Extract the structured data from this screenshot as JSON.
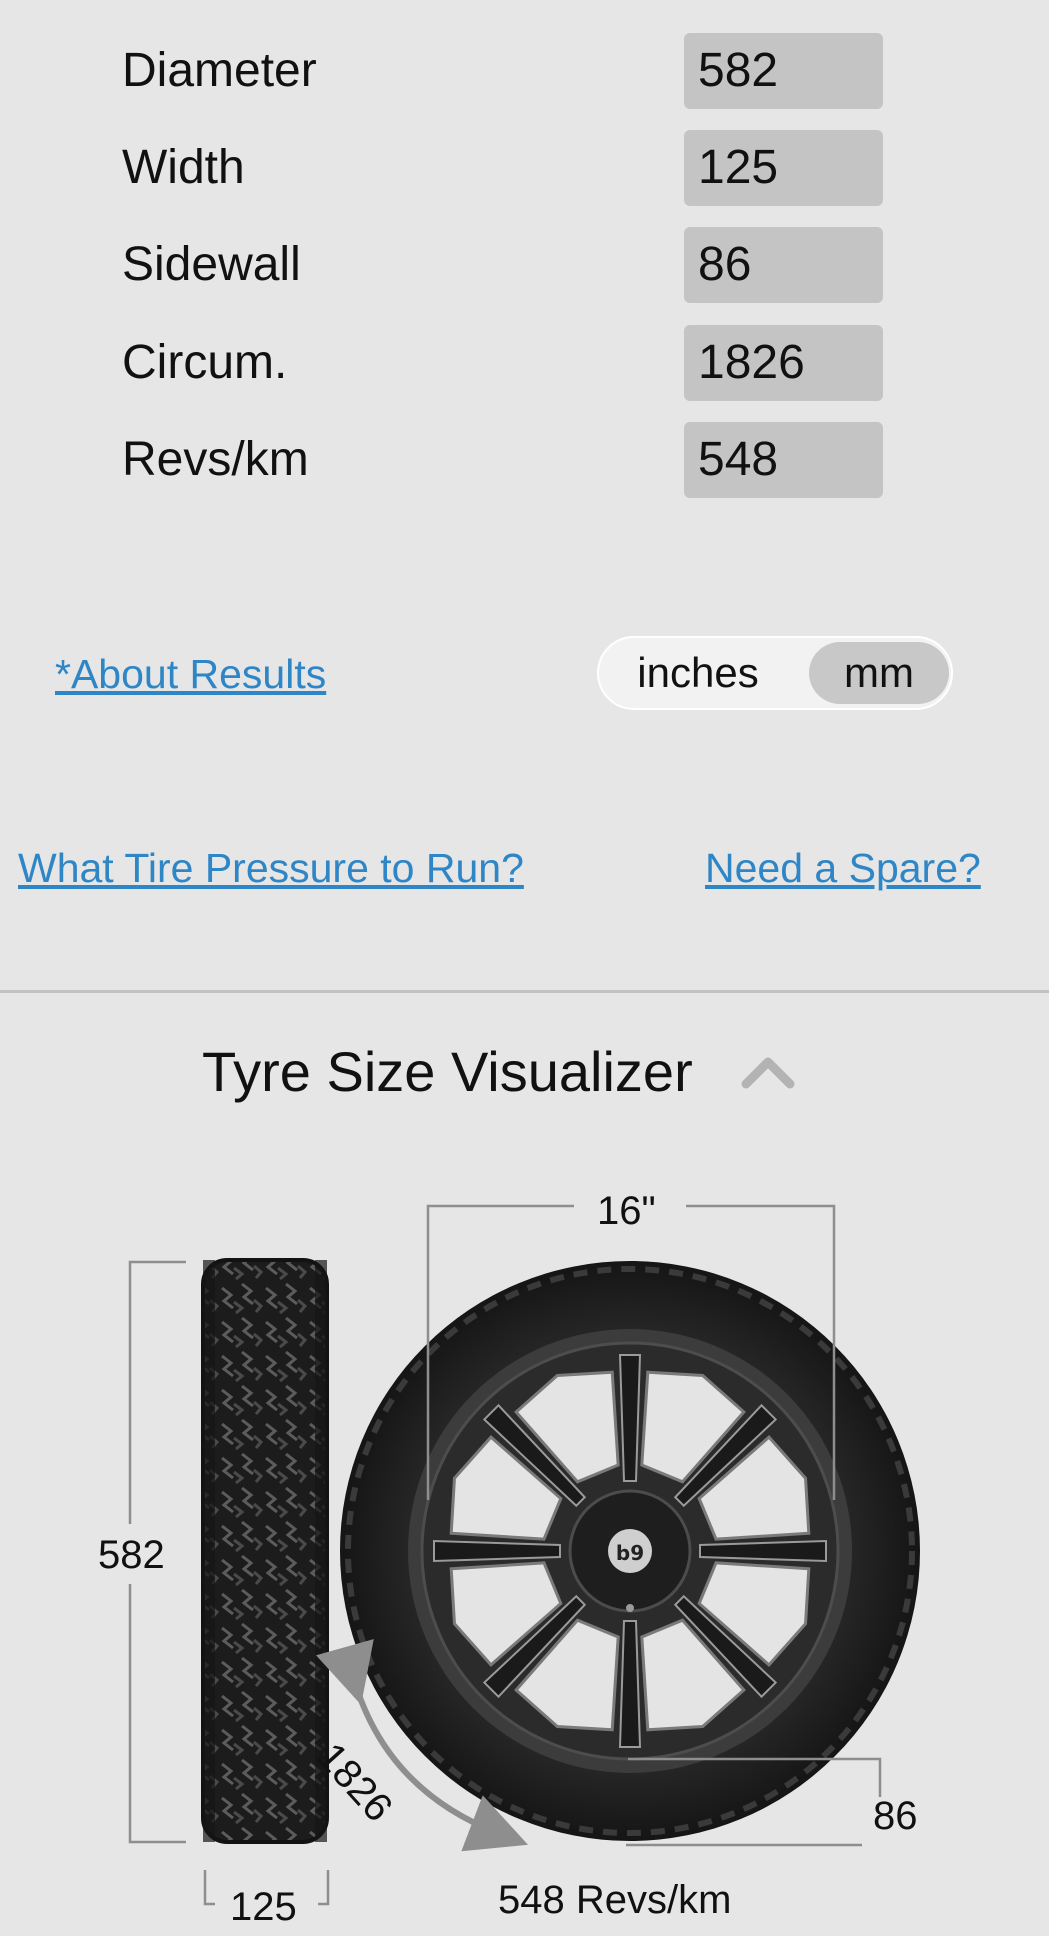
{
  "results": {
    "rows": [
      {
        "label": "Diameter",
        "value": "582"
      },
      {
        "label": "Width",
        "value": "125"
      },
      {
        "label": "Sidewall",
        "value": "86"
      },
      {
        "label": "Circum.",
        "value": "1826"
      },
      {
        "label": "Revs/km",
        "value": "548"
      }
    ]
  },
  "about_link": "*About Results",
  "unit_toggle": {
    "options": [
      "inches",
      "mm"
    ],
    "selected": "mm"
  },
  "links": {
    "pressure": "What Tire Pressure to Run?",
    "spare": "Need a Spare?"
  },
  "visualizer": {
    "title": "Tyre Size Visualizer",
    "collapse_icon": "chevron-up-icon",
    "rim_label": "16\"",
    "diameter_label": "582",
    "width_label": "125",
    "sidewall_label": "86",
    "circumference_label": "1826",
    "revs_label": "548 Revs/km",
    "hub_logo": "b9"
  },
  "colors": {
    "link": "#2f86c6",
    "background": "#e6e6e6",
    "value_box": "#c4c4c4"
  }
}
